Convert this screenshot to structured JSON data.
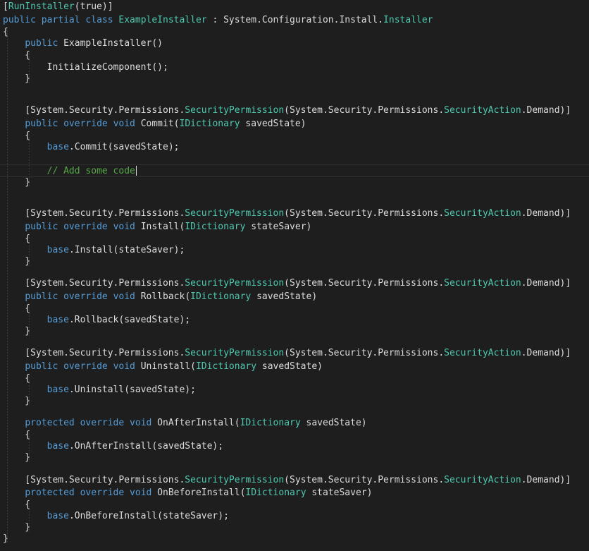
{
  "editor": {
    "lines": [
      [
        [
          "attr-bracket",
          "["
        ],
        [
          "attr",
          "RunInstaller"
        ],
        [
          "plain",
          "(true)]"
        ]
      ],
      [
        [
          "kw",
          "public"
        ],
        [
          "plain",
          " "
        ],
        [
          "kw",
          "partial"
        ],
        [
          "plain",
          " "
        ],
        [
          "kw",
          "class"
        ],
        [
          "plain",
          " "
        ],
        [
          "type",
          "ExampleInstaller"
        ],
        [
          "plain",
          " : System.Configuration.Install."
        ],
        [
          "type",
          "Installer"
        ]
      ],
      [
        [
          "plain",
          "{"
        ]
      ],
      [
        [
          "plain",
          "    "
        ],
        [
          "kw",
          "public"
        ],
        [
          "plain",
          " ExampleInstaller()"
        ]
      ],
      [
        [
          "plain",
          "    {"
        ]
      ],
      [
        [
          "plain",
          "        InitializeComponent();"
        ]
      ],
      [
        [
          "plain",
          "    }"
        ]
      ],
      [
        [
          "plain",
          ""
        ]
      ],
      [
        [
          "plain",
          ""
        ]
      ],
      [
        [
          "plain",
          "    [System.Security.Permissions."
        ],
        [
          "type",
          "SecurityPermission"
        ],
        [
          "plain",
          "(System.Security.Permissions."
        ],
        [
          "type",
          "SecurityAction"
        ],
        [
          "plain",
          ".Demand)]"
        ]
      ],
      [
        [
          "plain",
          "    "
        ],
        [
          "kw",
          "public"
        ],
        [
          "plain",
          " "
        ],
        [
          "kw",
          "override"
        ],
        [
          "plain",
          " "
        ],
        [
          "kw",
          "void"
        ],
        [
          "plain",
          " Commit("
        ],
        [
          "type",
          "IDictionary"
        ],
        [
          "plain",
          " savedState)"
        ]
      ],
      [
        [
          "plain",
          "    {"
        ]
      ],
      [
        [
          "plain",
          "        "
        ],
        [
          "kw",
          "base"
        ],
        [
          "plain",
          ".Commit(savedState);"
        ]
      ],
      [
        [
          "plain",
          ""
        ]
      ],
      [
        [
          "plain",
          "        "
        ],
        [
          "comment",
          "// Add some code"
        ],
        [
          "caret",
          ""
        ]
      ],
      [
        [
          "plain",
          "    }"
        ]
      ],
      [
        [
          "plain",
          ""
        ]
      ],
      [
        [
          "plain",
          ""
        ]
      ],
      [
        [
          "plain",
          "    [System.Security.Permissions."
        ],
        [
          "type",
          "SecurityPermission"
        ],
        [
          "plain",
          "(System.Security.Permissions."
        ],
        [
          "type",
          "SecurityAction"
        ],
        [
          "plain",
          ".Demand)]"
        ]
      ],
      [
        [
          "plain",
          "    "
        ],
        [
          "kw",
          "public"
        ],
        [
          "plain",
          " "
        ],
        [
          "kw",
          "override"
        ],
        [
          "plain",
          " "
        ],
        [
          "kw",
          "void"
        ],
        [
          "plain",
          " Install("
        ],
        [
          "type",
          "IDictionary"
        ],
        [
          "plain",
          " stateSaver)"
        ]
      ],
      [
        [
          "plain",
          "    {"
        ]
      ],
      [
        [
          "plain",
          "        "
        ],
        [
          "kw",
          "base"
        ],
        [
          "plain",
          ".Install(stateSaver);"
        ]
      ],
      [
        [
          "plain",
          "    }"
        ]
      ],
      [
        [
          "plain",
          ""
        ]
      ],
      [
        [
          "plain",
          "    [System.Security.Permissions."
        ],
        [
          "type",
          "SecurityPermission"
        ],
        [
          "plain",
          "(System.Security.Permissions."
        ],
        [
          "type",
          "SecurityAction"
        ],
        [
          "plain",
          ".Demand)]"
        ]
      ],
      [
        [
          "plain",
          "    "
        ],
        [
          "kw",
          "public"
        ],
        [
          "plain",
          " "
        ],
        [
          "kw",
          "override"
        ],
        [
          "plain",
          " "
        ],
        [
          "kw",
          "void"
        ],
        [
          "plain",
          " Rollback("
        ],
        [
          "type",
          "IDictionary"
        ],
        [
          "plain",
          " savedState)"
        ]
      ],
      [
        [
          "plain",
          "    {"
        ]
      ],
      [
        [
          "plain",
          "        "
        ],
        [
          "kw",
          "base"
        ],
        [
          "plain",
          ".Rollback(savedState);"
        ]
      ],
      [
        [
          "plain",
          "    }"
        ]
      ],
      [
        [
          "plain",
          ""
        ]
      ],
      [
        [
          "plain",
          "    [System.Security.Permissions."
        ],
        [
          "type",
          "SecurityPermission"
        ],
        [
          "plain",
          "(System.Security.Permissions."
        ],
        [
          "type",
          "SecurityAction"
        ],
        [
          "plain",
          ".Demand)]"
        ]
      ],
      [
        [
          "plain",
          "    "
        ],
        [
          "kw",
          "public"
        ],
        [
          "plain",
          " "
        ],
        [
          "kw",
          "override"
        ],
        [
          "plain",
          " "
        ],
        [
          "kw",
          "void"
        ],
        [
          "plain",
          " Uninstall("
        ],
        [
          "type",
          "IDictionary"
        ],
        [
          "plain",
          " savedState)"
        ]
      ],
      [
        [
          "plain",
          "    {"
        ]
      ],
      [
        [
          "plain",
          "        "
        ],
        [
          "kw",
          "base"
        ],
        [
          "plain",
          ".Uninstall(savedState);"
        ]
      ],
      [
        [
          "plain",
          "    }"
        ]
      ],
      [
        [
          "plain",
          ""
        ]
      ],
      [
        [
          "plain",
          "    "
        ],
        [
          "kw",
          "protected"
        ],
        [
          "plain",
          " "
        ],
        [
          "kw",
          "override"
        ],
        [
          "plain",
          " "
        ],
        [
          "kw",
          "void"
        ],
        [
          "plain",
          " OnAfterInstall("
        ],
        [
          "type",
          "IDictionary"
        ],
        [
          "plain",
          " savedState)"
        ]
      ],
      [
        [
          "plain",
          "    {"
        ]
      ],
      [
        [
          "plain",
          "        "
        ],
        [
          "kw",
          "base"
        ],
        [
          "plain",
          ".OnAfterInstall(savedState);"
        ]
      ],
      [
        [
          "plain",
          "    }"
        ]
      ],
      [
        [
          "plain",
          ""
        ]
      ],
      [
        [
          "plain",
          "    [System.Security.Permissions."
        ],
        [
          "type",
          "SecurityPermission"
        ],
        [
          "plain",
          "(System.Security.Permissions."
        ],
        [
          "type",
          "SecurityAction"
        ],
        [
          "plain",
          ".Demand)]"
        ]
      ],
      [
        [
          "plain",
          "    "
        ],
        [
          "kw",
          "protected"
        ],
        [
          "plain",
          " "
        ],
        [
          "kw",
          "override"
        ],
        [
          "plain",
          " "
        ],
        [
          "kw",
          "void"
        ],
        [
          "plain",
          " OnBeforeInstall("
        ],
        [
          "type",
          "IDictionary"
        ],
        [
          "plain",
          " stateSaver)"
        ]
      ],
      [
        [
          "plain",
          "    {"
        ]
      ],
      [
        [
          "plain",
          "        "
        ],
        [
          "kw",
          "base"
        ],
        [
          "plain",
          ".OnBeforeInstall(stateSaver);"
        ]
      ],
      [
        [
          "plain",
          "    }"
        ]
      ],
      [
        [
          "plain",
          "}"
        ]
      ]
    ],
    "current_line": 14
  },
  "colors": {
    "background": "#1e1e1e",
    "text": "#dcdcdc",
    "keyword": "#569cd6",
    "type": "#4ec9b0",
    "comment": "#57a64a"
  }
}
